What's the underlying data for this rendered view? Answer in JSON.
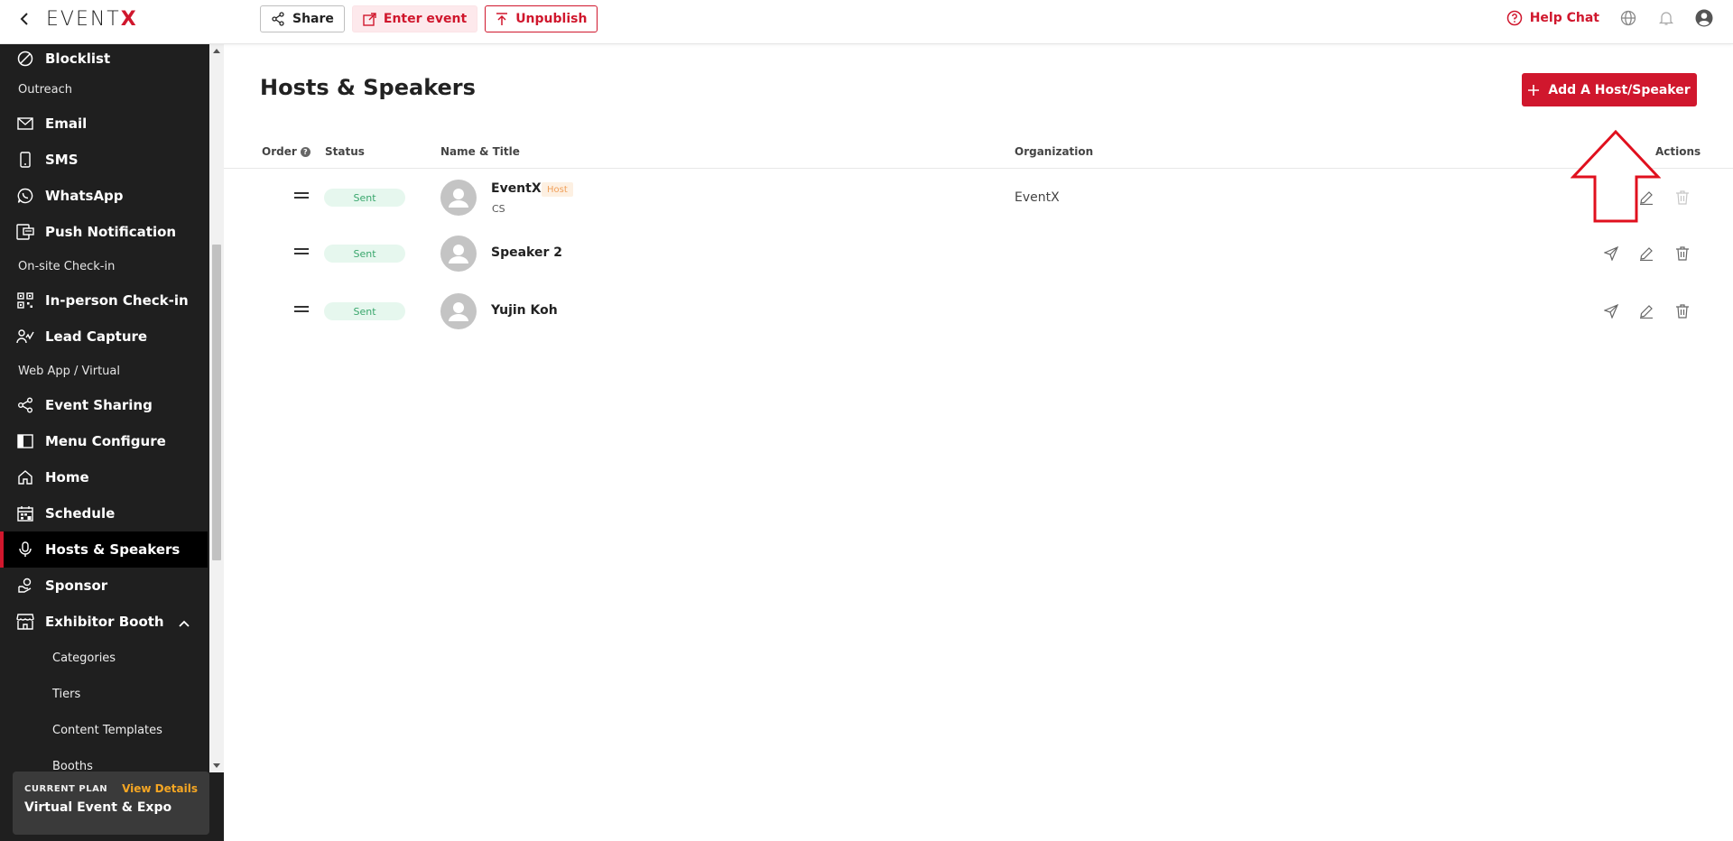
{
  "header": {
    "logo_main": "EVENT",
    "logo_x": "X",
    "share_label": "Share",
    "enter_label": "Enter event",
    "unpublish_label": "Unpublish",
    "help_label": "Help Chat"
  },
  "sidebar": {
    "blocklist": "Blocklist",
    "sec_outreach": "Outreach",
    "email": "Email",
    "sms": "SMS",
    "whatsapp": "WhatsApp",
    "push": "Push Notification",
    "sec_onsite": "On-site Check-in",
    "inperson": "In-person Check-in",
    "lead": "Lead Capture",
    "sec_webapp": "Web App / Virtual",
    "sharing": "Event Sharing",
    "menu": "Menu Configure",
    "home": "Home",
    "schedule": "Schedule",
    "hosts": "Hosts & Speakers",
    "sponsor": "Sponsor",
    "exhibitor": "Exhibitor Booth",
    "categories": "Categories",
    "tiers": "Tiers",
    "templates": "Content Templates",
    "booths": "Booths"
  },
  "plan": {
    "label": "CURRENT PLAN",
    "link": "View Details",
    "name": "Virtual Event & Expo"
  },
  "main": {
    "title": "Hosts & Speakers",
    "add_label": "Add A Host/Speaker",
    "columns": {
      "order": "Order",
      "status": "Status",
      "name": "Name & Title",
      "org": "Organization",
      "actions": "Actions"
    },
    "rows": [
      {
        "status": "Sent",
        "name": "EventX",
        "tag": "Host",
        "title": "CS",
        "org": "EventX"
      },
      {
        "status": "Sent",
        "name": "Speaker 2",
        "tag": "",
        "title": "",
        "org": ""
      },
      {
        "status": "Sent",
        "name": "Yujin Koh",
        "tag": "",
        "title": "",
        "org": ""
      }
    ]
  },
  "colors": {
    "brand_red": "#d0172d",
    "sidebar_bg": "#1f1f1f",
    "status_green": "#3aa76d"
  }
}
